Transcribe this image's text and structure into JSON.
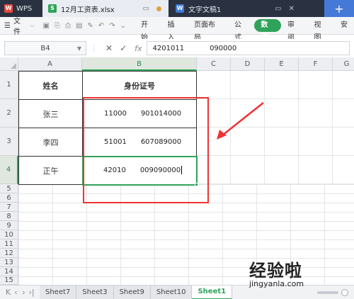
{
  "titlebar": {
    "app": "WPS",
    "doc_tab": "12月工资表.xlsx",
    "inactive_tab": "文字文稿1",
    "new_tab": "+"
  },
  "menubar": {
    "file_label": "文件",
    "tabs": [
      "开始",
      "插入",
      "页面布局",
      "公式",
      "数据",
      "审阅",
      "视图",
      "安"
    ],
    "active_tab": "数据"
  },
  "formula_bar": {
    "cell_ref": "B4",
    "cancel": "✕",
    "confirm": "✓",
    "fx": "fx",
    "value": "420101"
  },
  "columns": [
    "A",
    "B",
    "C",
    "D",
    "E",
    "F",
    "G"
  ],
  "rows": [
    "1",
    "2",
    "3",
    "4",
    "5",
    "6",
    "7",
    "8",
    "9",
    "10",
    "11",
    "12",
    "13",
    "14",
    "15",
    "16",
    "17",
    "18"
  ],
  "table": {
    "headers": [
      "姓名",
      "身份证号"
    ],
    "data": [
      {
        "name": "张三",
        "id_prefix": "11000",
        "id_suffix": "901014000"
      },
      {
        "name": "李四",
        "id_prefix": "51001",
        "id_suffix": "607089000"
      },
      {
        "name": "正午",
        "id_prefix": "42010",
        "id_suffix": "009090000"
      }
    ]
  },
  "formula_value_full_prefix": "4201011",
  "formula_value_suffix": "090000",
  "sheets": [
    "Sheet7",
    "Sheet3",
    "Sheet9",
    "Sheet10",
    "Sheet1"
  ],
  "active_sheet": "Sheet1",
  "watermark": {
    "title": "经验啦",
    "url": "jingyanla.com"
  },
  "colors": {
    "accent": "#2fa35a",
    "annotation": "#ee3333"
  }
}
